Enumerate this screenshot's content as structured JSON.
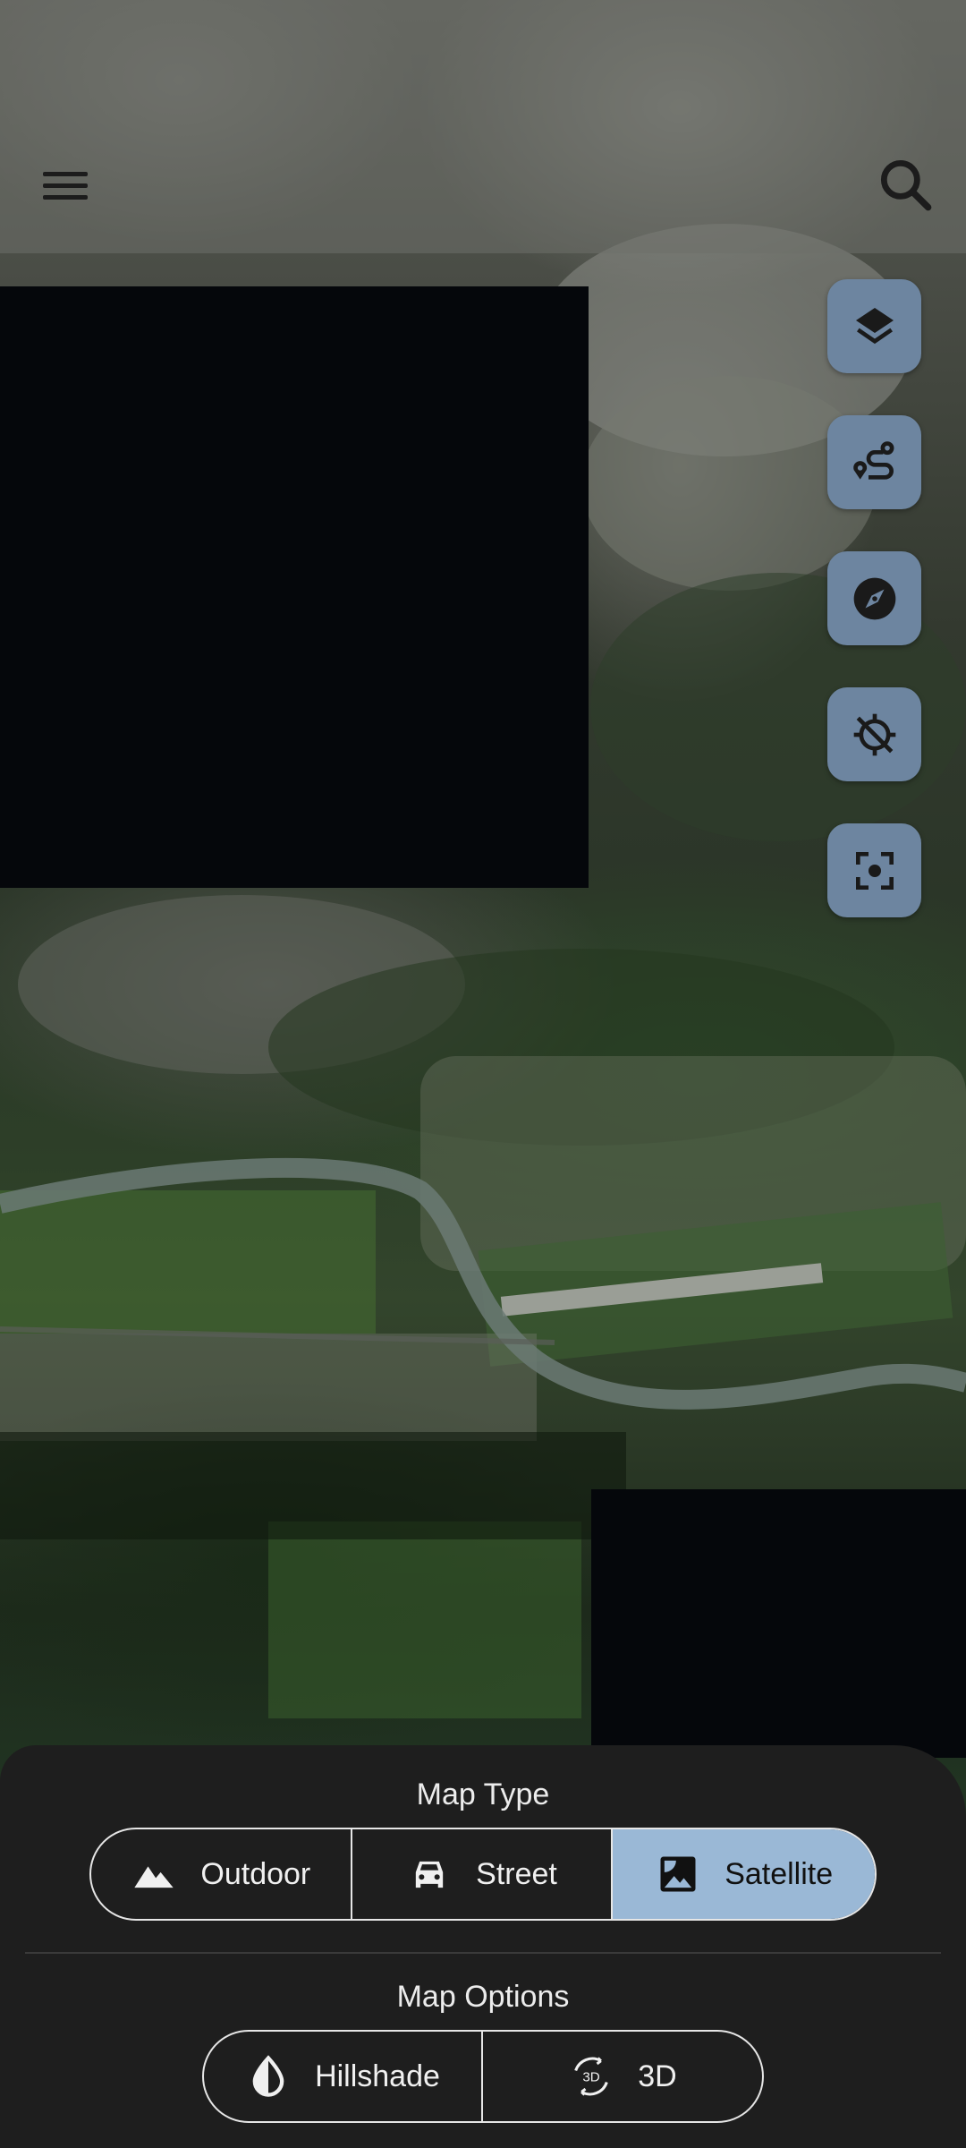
{
  "topbar": {
    "menu_icon": "menu-icon",
    "search_icon": "search-icon"
  },
  "map_controls": [
    {
      "name": "layers-button",
      "icon": "layers-icon"
    },
    {
      "name": "route-button",
      "icon": "route-icon"
    },
    {
      "name": "compass-button",
      "icon": "compass-icon"
    },
    {
      "name": "location-button",
      "icon": "location-disabled-icon"
    },
    {
      "name": "center-focus-button",
      "icon": "center-focus-icon"
    }
  ],
  "bottom_sheet": {
    "map_type_title": "Map Type",
    "map_types": [
      {
        "label": "Outdoor",
        "icon": "mountain-icon",
        "selected": false
      },
      {
        "label": "Street",
        "icon": "car-icon",
        "selected": false
      },
      {
        "label": "Satellite",
        "icon": "satellite-image-icon",
        "selected": true
      }
    ],
    "map_options_title": "Map Options",
    "map_options": [
      {
        "label": "Hillshade",
        "icon": "hillshade-drop-icon"
      },
      {
        "label": "3D",
        "icon": "3d-rotation-icon"
      }
    ]
  },
  "colors": {
    "fab_background": "#6d85a0",
    "selected_segment": "#9ab8d6",
    "sheet_background": "#1e1e1e"
  }
}
